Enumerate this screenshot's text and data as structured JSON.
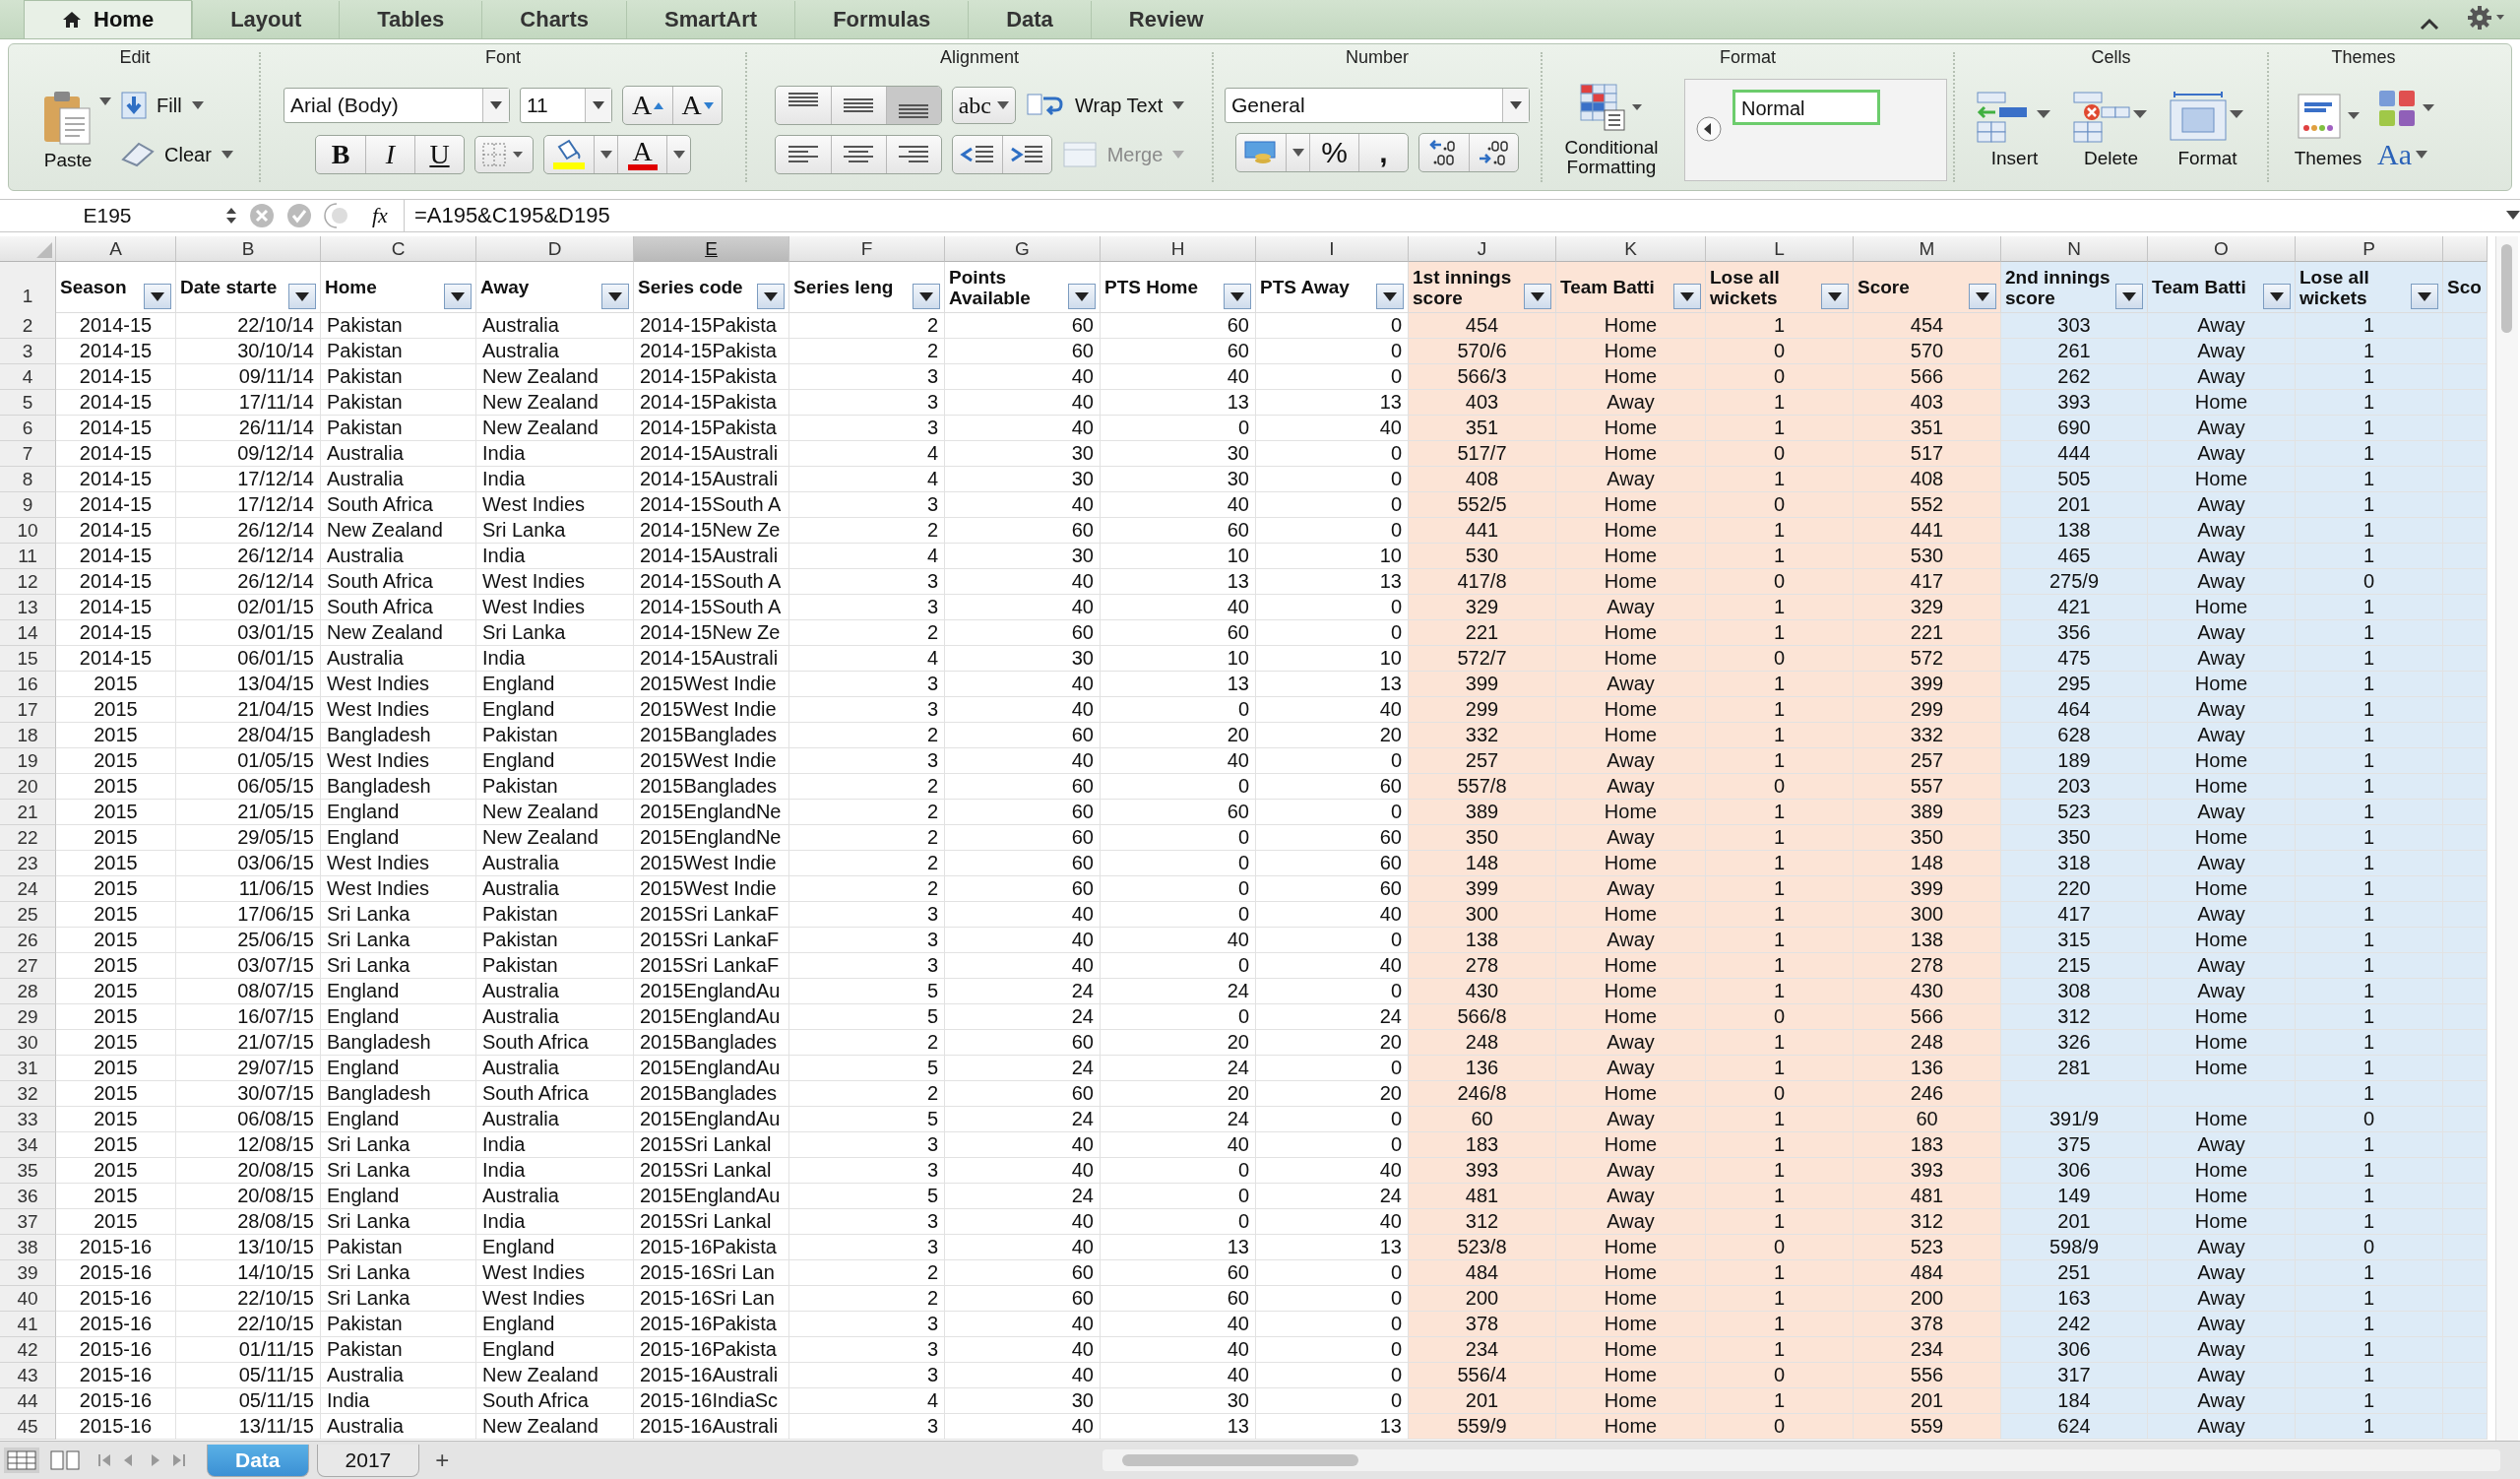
{
  "ribbon_tabs": [
    {
      "label": "Home",
      "selected": true
    },
    {
      "label": "Layout",
      "selected": false
    },
    {
      "label": "Tables",
      "selected": false
    },
    {
      "label": "Charts",
      "selected": false
    },
    {
      "label": "SmartArt",
      "selected": false
    },
    {
      "label": "Formulas",
      "selected": false
    },
    {
      "label": "Data",
      "selected": false
    },
    {
      "label": "Review",
      "selected": false
    }
  ],
  "edit": {
    "title": "Edit",
    "paste": "Paste",
    "fill": "Fill",
    "clear": "Clear"
  },
  "font": {
    "title": "Font",
    "name": "Arial (Body)",
    "size": "11",
    "grow": "A",
    "shrink": "A",
    "bold": "B",
    "italic": "I",
    "underline": "U",
    "color_letter": "A"
  },
  "alignment": {
    "title": "Alignment",
    "orientation": "abc",
    "wrap_text": "Wrap Text",
    "merge": {
      "label": "Merge",
      "disabled": true
    }
  },
  "number": {
    "title": "Number",
    "format": "General",
    "percent": "%",
    "comma": ","
  },
  "format": {
    "title": "Format",
    "conditional": "Conditional Formatting",
    "style": "Normal"
  },
  "cells": {
    "title": "Cells",
    "insert": "Insert",
    "delete": "Delete",
    "format": "Format"
  },
  "themes": {
    "title": "Themes",
    "themes": "Themes",
    "fonts": "Aa"
  },
  "formula_bar": {
    "cell": "E195",
    "fx": "fx",
    "formula": "=A195&C195&D195"
  },
  "columns": [
    {
      "letter": "A",
      "selected": false
    },
    {
      "letter": "B",
      "selected": false
    },
    {
      "letter": "C",
      "selected": false
    },
    {
      "letter": "D",
      "selected": false
    },
    {
      "letter": "E",
      "selected": true
    },
    {
      "letter": "F",
      "selected": false
    },
    {
      "letter": "G",
      "selected": false
    },
    {
      "letter": "H",
      "selected": false
    },
    {
      "letter": "I",
      "selected": false
    },
    {
      "letter": "J",
      "selected": false
    },
    {
      "letter": "K",
      "selected": false
    },
    {
      "letter": "L",
      "selected": false
    },
    {
      "letter": "M",
      "selected": false
    },
    {
      "letter": "N",
      "selected": false
    },
    {
      "letter": "O",
      "selected": false
    },
    {
      "letter": "P",
      "selected": false
    }
  ],
  "header_row": {
    "number": "1",
    "headers": [
      {
        "label": "Season",
        "color": "#ffffff"
      },
      {
        "label": "Date starte",
        "color": "#ffffff"
      },
      {
        "label": "Home",
        "color": "#ffffff"
      },
      {
        "label": "Away",
        "color": "#ffffff"
      },
      {
        "label": "Series code",
        "color": "#ffffff"
      },
      {
        "label": "Series leng",
        "color": "#ffffff"
      },
      {
        "label": "Points Available",
        "color": "#ffffff"
      },
      {
        "label": "PTS Home",
        "color": "#ffffff"
      },
      {
        "label": "PTS Away",
        "color": "#ffffff"
      },
      {
        "label": "1st innings score",
        "color": "#fce4d6"
      },
      {
        "label": "Team Batti",
        "color": "#fce4d6"
      },
      {
        "label": "Lose all wickets",
        "color": "#fce4d6"
      },
      {
        "label": "Score",
        "color": "#fce4d6"
      },
      {
        "label": "2nd innings score",
        "color": "#ddebf7"
      },
      {
        "label": "Team Batti",
        "color": "#ddebf7"
      },
      {
        "label": "Lose all wickets",
        "color": "#ddebf7"
      },
      {
        "label": "Sco",
        "color": "#ddebf7"
      }
    ]
  },
  "rows": [
    {
      "n": "2",
      "cells": [
        "2014-15",
        "22/10/14",
        "Pakistan",
        "Australia",
        "2014-15Pakista",
        "2",
        "60",
        "60",
        "0",
        "454",
        "Home",
        "1",
        "454",
        "303",
        "Away",
        "1"
      ]
    },
    {
      "n": "3",
      "cells": [
        "2014-15",
        "30/10/14",
        "Pakistan",
        "Australia",
        "2014-15Pakista",
        "2",
        "60",
        "60",
        "0",
        "570/6",
        "Home",
        "0",
        "570",
        "261",
        "Away",
        "1"
      ]
    },
    {
      "n": "4",
      "cells": [
        "2014-15",
        "09/11/14",
        "Pakistan",
        "New Zealand",
        "2014-15Pakista",
        "3",
        "40",
        "40",
        "0",
        "566/3",
        "Home",
        "0",
        "566",
        "262",
        "Away",
        "1"
      ]
    },
    {
      "n": "5",
      "cells": [
        "2014-15",
        "17/11/14",
        "Pakistan",
        "New Zealand",
        "2014-15Pakista",
        "3",
        "40",
        "13",
        "13",
        "403",
        "Away",
        "1",
        "403",
        "393",
        "Home",
        "1"
      ]
    },
    {
      "n": "6",
      "cells": [
        "2014-15",
        "26/11/14",
        "Pakistan",
        "New Zealand",
        "2014-15Pakista",
        "3",
        "40",
        "0",
        "40",
        "351",
        "Home",
        "1",
        "351",
        "690",
        "Away",
        "1"
      ]
    },
    {
      "n": "7",
      "cells": [
        "2014-15",
        "09/12/14",
        "Australia",
        "India",
        "2014-15Australi",
        "4",
        "30",
        "30",
        "0",
        "517/7",
        "Home",
        "0",
        "517",
        "444",
        "Away",
        "1"
      ]
    },
    {
      "n": "8",
      "cells": [
        "2014-15",
        "17/12/14",
        "Australia",
        "India",
        "2014-15Australi",
        "4",
        "30",
        "30",
        "0",
        "408",
        "Away",
        "1",
        "408",
        "505",
        "Home",
        "1"
      ]
    },
    {
      "n": "9",
      "cells": [
        "2014-15",
        "17/12/14",
        "South Africa",
        "West Indies",
        "2014-15South A",
        "3",
        "40",
        "40",
        "0",
        "552/5",
        "Home",
        "0",
        "552",
        "201",
        "Away",
        "1"
      ]
    },
    {
      "n": "10",
      "cells": [
        "2014-15",
        "26/12/14",
        "New Zealand",
        "Sri Lanka",
        "2014-15New Ze",
        "2",
        "60",
        "60",
        "0",
        "441",
        "Home",
        "1",
        "441",
        "138",
        "Away",
        "1"
      ]
    },
    {
      "n": "11",
      "cells": [
        "2014-15",
        "26/12/14",
        "Australia",
        "India",
        "2014-15Australi",
        "4",
        "30",
        "10",
        "10",
        "530",
        "Home",
        "1",
        "530",
        "465",
        "Away",
        "1"
      ]
    },
    {
      "n": "12",
      "cells": [
        "2014-15",
        "26/12/14",
        "South Africa",
        "West Indies",
        "2014-15South A",
        "3",
        "40",
        "13",
        "13",
        "417/8",
        "Home",
        "0",
        "417",
        "275/9",
        "Away",
        "0"
      ]
    },
    {
      "n": "13",
      "cells": [
        "2014-15",
        "02/01/15",
        "South Africa",
        "West Indies",
        "2014-15South A",
        "3",
        "40",
        "40",
        "0",
        "329",
        "Away",
        "1",
        "329",
        "421",
        "Home",
        "1"
      ]
    },
    {
      "n": "14",
      "cells": [
        "2014-15",
        "03/01/15",
        "New Zealand",
        "Sri Lanka",
        "2014-15New Ze",
        "2",
        "60",
        "60",
        "0",
        "221",
        "Home",
        "1",
        "221",
        "356",
        "Away",
        "1"
      ]
    },
    {
      "n": "15",
      "cells": [
        "2014-15",
        "06/01/15",
        "Australia",
        "India",
        "2014-15Australi",
        "4",
        "30",
        "10",
        "10",
        "572/7",
        "Home",
        "0",
        "572",
        "475",
        "Away",
        "1"
      ]
    },
    {
      "n": "16",
      "cells": [
        "2015",
        "13/04/15",
        "West Indies",
        "England",
        "2015West Indie",
        "3",
        "40",
        "13",
        "13",
        "399",
        "Away",
        "1",
        "399",
        "295",
        "Home",
        "1"
      ]
    },
    {
      "n": "17",
      "cells": [
        "2015",
        "21/04/15",
        "West Indies",
        "England",
        "2015West Indie",
        "3",
        "40",
        "0",
        "40",
        "299",
        "Home",
        "1",
        "299",
        "464",
        "Away",
        "1"
      ]
    },
    {
      "n": "18",
      "cells": [
        "2015",
        "28/04/15",
        "Bangladesh",
        "Pakistan",
        "2015Banglades",
        "2",
        "60",
        "20",
        "20",
        "332",
        "Home",
        "1",
        "332",
        "628",
        "Away",
        "1"
      ]
    },
    {
      "n": "19",
      "cells": [
        "2015",
        "01/05/15",
        "West Indies",
        "England",
        "2015West Indie",
        "3",
        "40",
        "40",
        "0",
        "257",
        "Away",
        "1",
        "257",
        "189",
        "Home",
        "1"
      ]
    },
    {
      "n": "20",
      "cells": [
        "2015",
        "06/05/15",
        "Bangladesh",
        "Pakistan",
        "2015Banglades",
        "2",
        "60",
        "0",
        "60",
        "557/8",
        "Away",
        "0",
        "557",
        "203",
        "Home",
        "1"
      ]
    },
    {
      "n": "21",
      "cells": [
        "2015",
        "21/05/15",
        "England",
        "New Zealand",
        "2015EnglandNe",
        "2",
        "60",
        "60",
        "0",
        "389",
        "Home",
        "1",
        "389",
        "523",
        "Away",
        "1"
      ]
    },
    {
      "n": "22",
      "cells": [
        "2015",
        "29/05/15",
        "England",
        "New Zealand",
        "2015EnglandNe",
        "2",
        "60",
        "0",
        "60",
        "350",
        "Away",
        "1",
        "350",
        "350",
        "Home",
        "1"
      ]
    },
    {
      "n": "23",
      "cells": [
        "2015",
        "03/06/15",
        "West Indies",
        "Australia",
        "2015West Indie",
        "2",
        "60",
        "0",
        "60",
        "148",
        "Home",
        "1",
        "148",
        "318",
        "Away",
        "1"
      ]
    },
    {
      "n": "24",
      "cells": [
        "2015",
        "11/06/15",
        "West Indies",
        "Australia",
        "2015West Indie",
        "2",
        "60",
        "0",
        "60",
        "399",
        "Away",
        "1",
        "399",
        "220",
        "Home",
        "1"
      ]
    },
    {
      "n": "25",
      "cells": [
        "2015",
        "17/06/15",
        "Sri Lanka",
        "Pakistan",
        "2015Sri LankaF",
        "3",
        "40",
        "0",
        "40",
        "300",
        "Home",
        "1",
        "300",
        "417",
        "Away",
        "1"
      ]
    },
    {
      "n": "26",
      "cells": [
        "2015",
        "25/06/15",
        "Sri Lanka",
        "Pakistan",
        "2015Sri LankaF",
        "3",
        "40",
        "40",
        "0",
        "138",
        "Away",
        "1",
        "138",
        "315",
        "Home",
        "1"
      ]
    },
    {
      "n": "27",
      "cells": [
        "2015",
        "03/07/15",
        "Sri Lanka",
        "Pakistan",
        "2015Sri LankaF",
        "3",
        "40",
        "0",
        "40",
        "278",
        "Home",
        "1",
        "278",
        "215",
        "Away",
        "1"
      ]
    },
    {
      "n": "28",
      "cells": [
        "2015",
        "08/07/15",
        "England",
        "Australia",
        "2015EnglandAu",
        "5",
        "24",
        "24",
        "0",
        "430",
        "Home",
        "1",
        "430",
        "308",
        "Away",
        "1"
      ]
    },
    {
      "n": "29",
      "cells": [
        "2015",
        "16/07/15",
        "England",
        "Australia",
        "2015EnglandAu",
        "5",
        "24",
        "0",
        "24",
        "566/8",
        "Home",
        "0",
        "566",
        "312",
        "Home",
        "1"
      ]
    },
    {
      "n": "30",
      "cells": [
        "2015",
        "21/07/15",
        "Bangladesh",
        "South Africa",
        "2015Banglades",
        "2",
        "60",
        "20",
        "20",
        "248",
        "Away",
        "1",
        "248",
        "326",
        "Home",
        "1"
      ]
    },
    {
      "n": "31",
      "cells": [
        "2015",
        "29/07/15",
        "England",
        "Australia",
        "2015EnglandAu",
        "5",
        "24",
        "24",
        "0",
        "136",
        "Away",
        "1",
        "136",
        "281",
        "Home",
        "1"
      ]
    },
    {
      "n": "32",
      "cells": [
        "2015",
        "30/07/15",
        "Bangladesh",
        "South Africa",
        "2015Banglades",
        "2",
        "60",
        "20",
        "20",
        "246/8",
        "Home",
        "0",
        "246",
        null,
        null,
        "1"
      ]
    },
    {
      "n": "33",
      "cells": [
        "2015",
        "06/08/15",
        "England",
        "Australia",
        "2015EnglandAu",
        "5",
        "24",
        "24",
        "0",
        "60",
        "Away",
        "1",
        "60",
        "391/9",
        "Home",
        "0"
      ]
    },
    {
      "n": "34",
      "cells": [
        "2015",
        "12/08/15",
        "Sri Lanka",
        "India",
        "2015Sri Lankal",
        "3",
        "40",
        "40",
        "0",
        "183",
        "Home",
        "1",
        "183",
        "375",
        "Away",
        "1"
      ]
    },
    {
      "n": "35",
      "cells": [
        "2015",
        "20/08/15",
        "Sri Lanka",
        "India",
        "2015Sri Lankal",
        "3",
        "40",
        "0",
        "40",
        "393",
        "Away",
        "1",
        "393",
        "306",
        "Home",
        "1"
      ]
    },
    {
      "n": "36",
      "cells": [
        "2015",
        "20/08/15",
        "England",
        "Australia",
        "2015EnglandAu",
        "5",
        "24",
        "0",
        "24",
        "481",
        "Away",
        "1",
        "481",
        "149",
        "Home",
        "1"
      ]
    },
    {
      "n": "37",
      "cells": [
        "2015",
        "28/08/15",
        "Sri Lanka",
        "India",
        "2015Sri Lankal",
        "3",
        "40",
        "0",
        "40",
        "312",
        "Away",
        "1",
        "312",
        "201",
        "Home",
        "1"
      ]
    },
    {
      "n": "38",
      "cells": [
        "2015-16",
        "13/10/15",
        "Pakistan",
        "England",
        "2015-16Pakista",
        "3",
        "40",
        "13",
        "13",
        "523/8",
        "Home",
        "0",
        "523",
        "598/9",
        "Away",
        "0"
      ]
    },
    {
      "n": "39",
      "cells": [
        "2015-16",
        "14/10/15",
        "Sri Lanka",
        "West Indies",
        "2015-16Sri Lan",
        "2",
        "60",
        "60",
        "0",
        "484",
        "Home",
        "1",
        "484",
        "251",
        "Away",
        "1"
      ]
    },
    {
      "n": "40",
      "cells": [
        "2015-16",
        "22/10/15",
        "Sri Lanka",
        "West Indies",
        "2015-16Sri Lan",
        "2",
        "60",
        "60",
        "0",
        "200",
        "Home",
        "1",
        "200",
        "163",
        "Away",
        "1"
      ]
    },
    {
      "n": "41",
      "cells": [
        "2015-16",
        "22/10/15",
        "Pakistan",
        "England",
        "2015-16Pakista",
        "3",
        "40",
        "40",
        "0",
        "378",
        "Home",
        "1",
        "378",
        "242",
        "Away",
        "1"
      ]
    },
    {
      "n": "42",
      "cells": [
        "2015-16",
        "01/11/15",
        "Pakistan",
        "England",
        "2015-16Pakista",
        "3",
        "40",
        "40",
        "0",
        "234",
        "Home",
        "1",
        "234",
        "306",
        "Away",
        "1"
      ]
    },
    {
      "n": "43",
      "cells": [
        "2015-16",
        "05/11/15",
        "Australia",
        "New Zealand",
        "2015-16Australi",
        "3",
        "40",
        "40",
        "0",
        "556/4",
        "Home",
        "0",
        "556",
        "317",
        "Away",
        "1"
      ]
    },
    {
      "n": "44",
      "cells": [
        "2015-16",
        "05/11/15",
        "India",
        "South Africa",
        "2015-16IndiaSc",
        "4",
        "30",
        "30",
        "0",
        "201",
        "Home",
        "1",
        "201",
        "184",
        "Away",
        "1"
      ]
    },
    {
      "n": "45",
      "cells": [
        "2015-16",
        "13/11/15",
        "Australia",
        "New Zealand",
        "2015-16Australi",
        "3",
        "40",
        "13",
        "13",
        "559/9",
        "Home",
        "0",
        "559",
        "624",
        "Away",
        "1"
      ]
    }
  ],
  "sheet_tabs": [
    {
      "label": "Data",
      "selected": true
    },
    {
      "label": "2017",
      "selected": false
    }
  ],
  "add_sheet": "+"
}
